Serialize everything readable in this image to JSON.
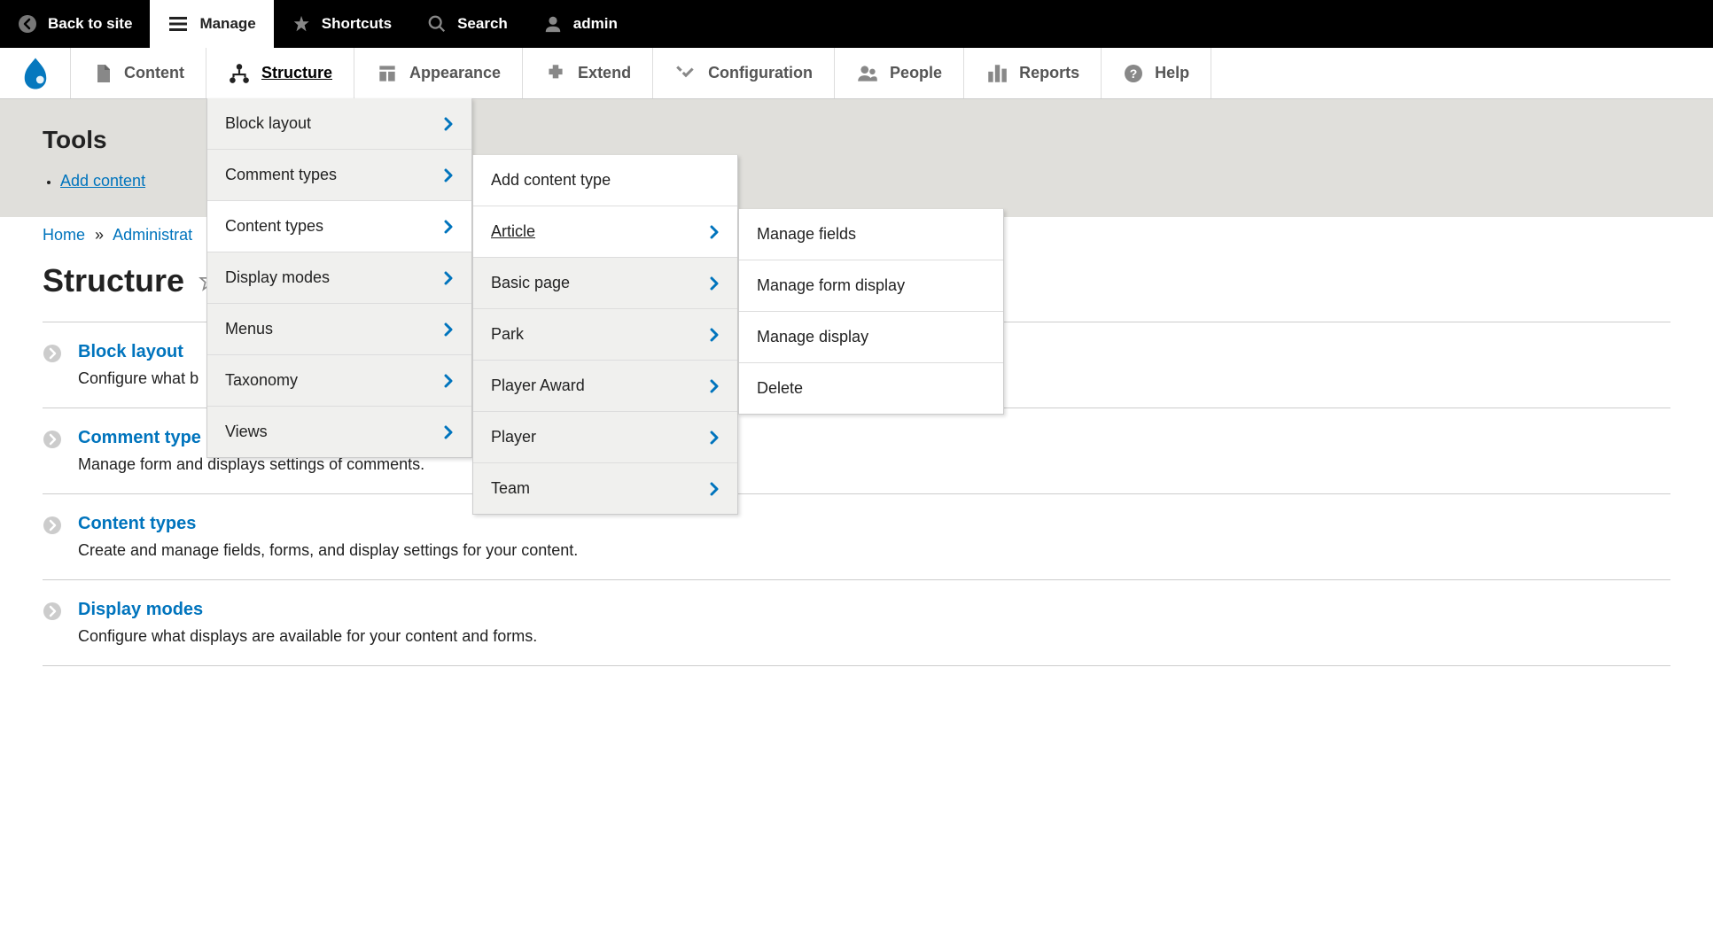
{
  "toolbar": {
    "back": "Back to site",
    "manage": "Manage",
    "shortcuts": "Shortcuts",
    "search": "Search",
    "user": "admin"
  },
  "admin_menu": {
    "content": "Content",
    "structure": "Structure",
    "appearance": "Appearance",
    "extend": "Extend",
    "configuration": "Configuration",
    "people": "People",
    "reports": "Reports",
    "help": "Help"
  },
  "structure_submenu": {
    "block_layout": "Block layout",
    "comment_types": "Comment types",
    "content_types": "Content types",
    "display_modes": "Display modes",
    "menus": "Menus",
    "taxonomy": "Taxonomy",
    "views": "Views"
  },
  "content_types_submenu": {
    "add": "Add content type",
    "article": "Article",
    "basic_page": "Basic page",
    "park": "Park",
    "player_award": "Player Award",
    "player": "Player",
    "team": "Team"
  },
  "article_submenu": {
    "manage_fields": "Manage fields",
    "manage_form_display": "Manage form display",
    "manage_display": "Manage display",
    "delete": "Delete"
  },
  "tools": {
    "title": "Tools",
    "add_content": "Add content"
  },
  "breadcrumb": {
    "home": "Home",
    "admin": "Administrat"
  },
  "page_title": "Structure",
  "list": {
    "block_layout": {
      "title": "Block layout",
      "desc": "Configure what b"
    },
    "comment_types": {
      "title": "Comment type",
      "desc": "Manage form and displays settings of comments."
    },
    "content_types": {
      "title": "Content types",
      "desc": "Create and manage fields, forms, and display settings for your content."
    },
    "display_modes": {
      "title": "Display modes",
      "desc": "Configure what displays are available for your content and forms."
    }
  }
}
